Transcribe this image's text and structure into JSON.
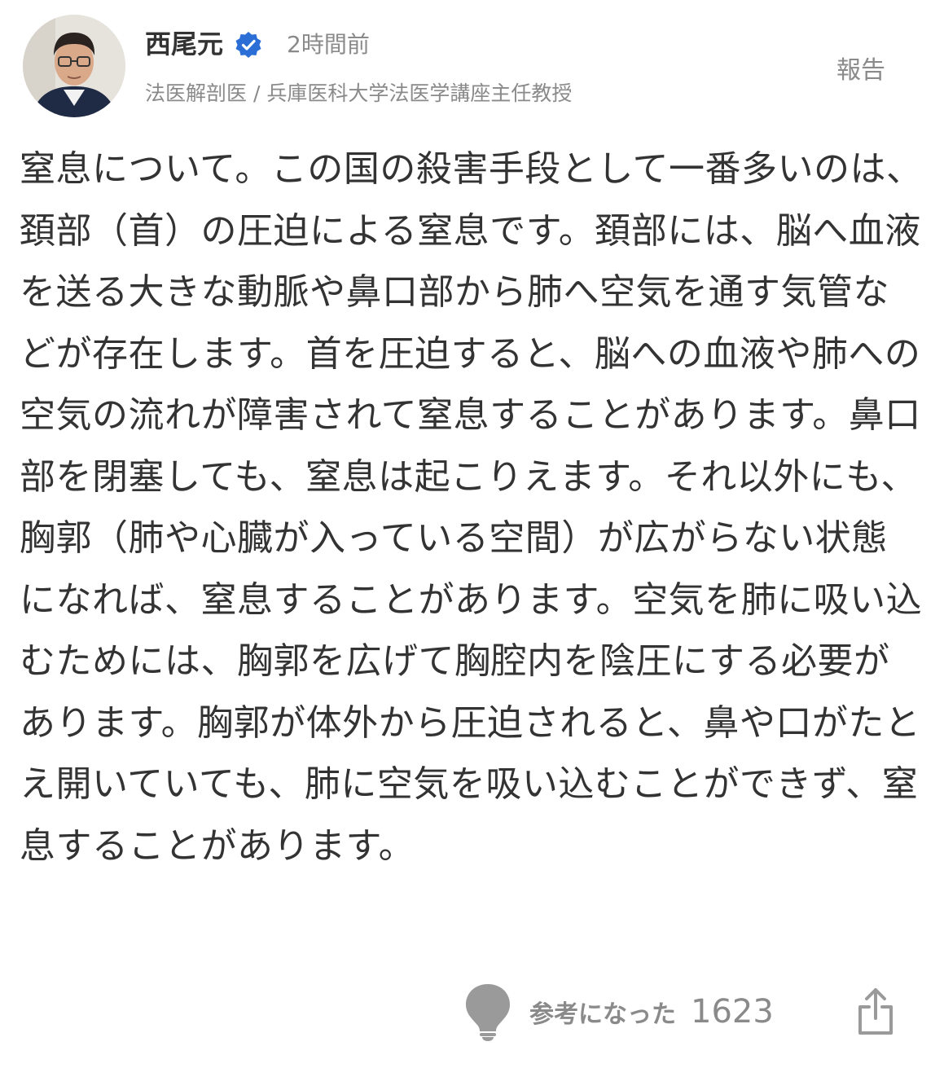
{
  "author": {
    "name": "西尾元",
    "verified_icon": "verified-badge-icon",
    "time_ago": "2時間前",
    "title": "法医解剖医 / 兵庫医科大学法医学講座主任教授"
  },
  "actions": {
    "report_label": "報告",
    "helpful_label": "参考になった",
    "helpful_count": "1623",
    "share_icon": "share-icon",
    "helpful_icon": "lightbulb-icon"
  },
  "comment": {
    "text": "窒息について。この国の殺害手段として一番多いのは、頚部（首）の圧迫による窒息です。頚部には、脳へ血液を送る大きな動脈や鼻口部から肺へ空気を通す気管などが存在します。首を圧迫すると、脳への血液や肺への空気の流れが障害されて窒息することがあります。鼻口部を閉塞しても、窒息は起こりえます。それ以外にも、胸郭（肺や心臓が入っている空間）が広がらない状態になれば、窒息することがあります。空気を肺に吸い込むためには、胸郭を広げて胸腔内を陰圧にする必要があります。胸郭が体外から圧迫されると、鼻や口がたとえ開いていても、肺に空気を吸い込むことができず、窒息することがあります。"
  },
  "colors": {
    "text_main": "#333333",
    "text_muted": "#8a8a8a",
    "verified_blue": "#2b6fd6",
    "icon_gray": "#9a9a9a"
  }
}
